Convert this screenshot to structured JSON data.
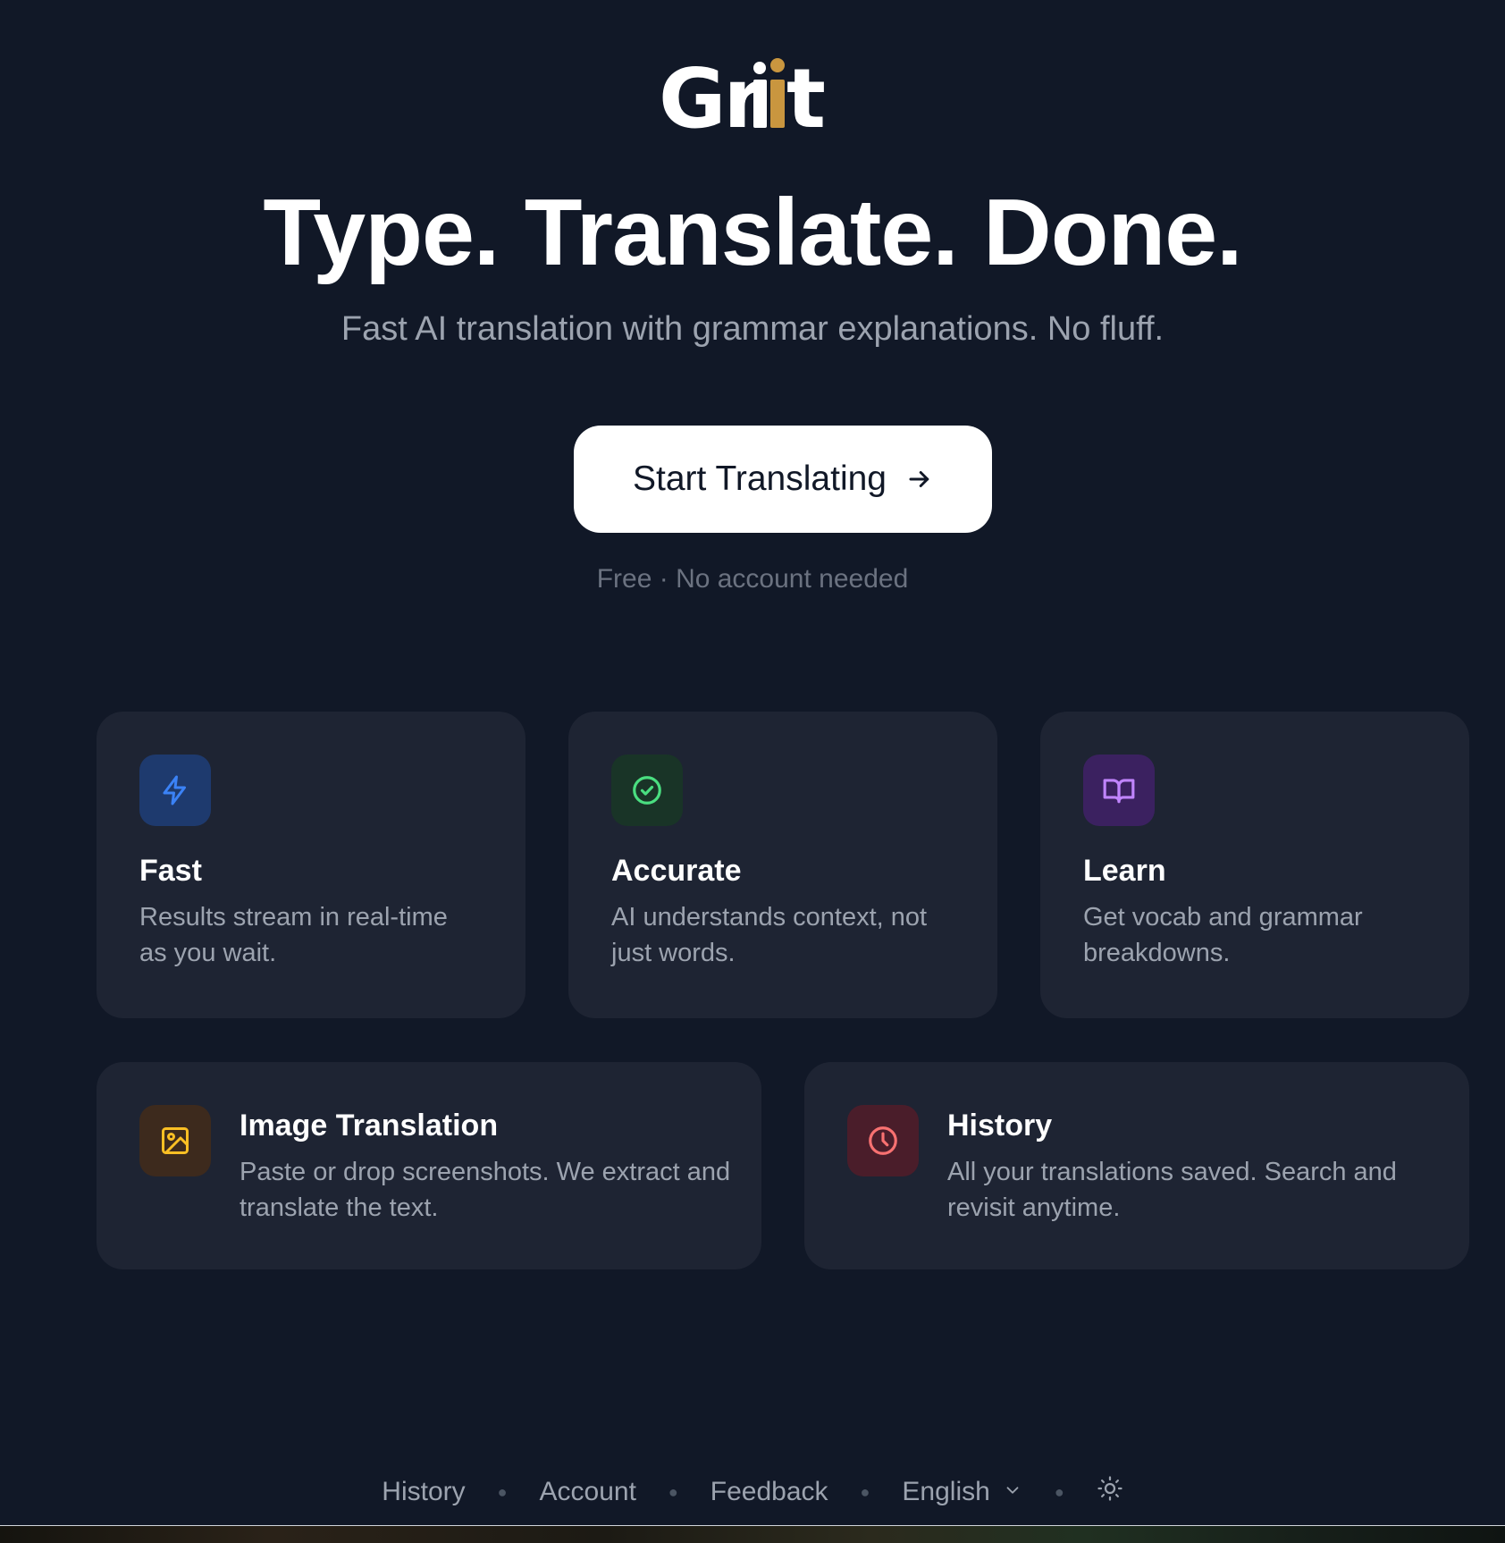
{
  "brand": {
    "logo_text": "Griit",
    "accent": "#c9963f"
  },
  "hero": {
    "headline": "Type. Translate. Done.",
    "subheadline": "Fast AI translation with grammar explanations. No fluff.",
    "cta_label": "Start Translating",
    "cta_icon": "arrow-right-icon",
    "note": "Free · No account needed"
  },
  "features": [
    {
      "icon": "lightning-icon",
      "title": "Fast",
      "description": "Results stream in real-time as you wait.",
      "icon_color": "#3b82f6",
      "icon_bg": "#1e3a6e"
    },
    {
      "icon": "check-circle-icon",
      "title": "Accurate",
      "description": "AI understands context, not just words.",
      "icon_color": "#4ade80",
      "icon_bg": "#193427"
    },
    {
      "icon": "book-icon",
      "title": "Learn",
      "description": "Get vocab and grammar breakdowns.",
      "icon_color": "#c084fc",
      "icon_bg": "#3b2160"
    }
  ],
  "wide_features": [
    {
      "icon": "image-icon",
      "title": "Image Translation",
      "description": "Paste or drop screenshots. We extract and translate the text.",
      "icon_color": "#fbbf24",
      "icon_bg": "#3d2a1d"
    },
    {
      "icon": "clock-icon",
      "title": "History",
      "description": "All your translations saved. Search and revisit anytime.",
      "icon_color": "#f87171",
      "icon_bg": "#4a1d2a"
    }
  ],
  "footer": {
    "links": [
      "History",
      "Account",
      "Feedback"
    ],
    "language": "English",
    "language_icon": "chevron-down-icon",
    "theme_icon": "sun-icon"
  }
}
